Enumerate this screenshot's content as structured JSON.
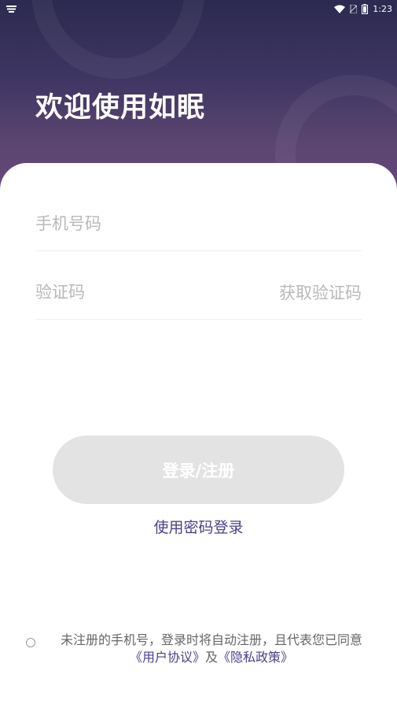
{
  "status_bar": {
    "time": "1:23",
    "icons": [
      "notification-icon",
      "wifi-icon",
      "no-sim-icon",
      "battery-icon"
    ]
  },
  "header": {
    "title": "欢迎使用如眠"
  },
  "form": {
    "phone_placeholder": "手机号码",
    "code_placeholder": "验证码",
    "get_code_label": "获取验证码",
    "submit_label": "登录/注册",
    "password_login_label": "使用密码登录"
  },
  "agreement": {
    "text": "未注册的手机号，登录时将自动注册，且代表您已同意",
    "user_agreement": "《用户协议》",
    "conjunction": "及",
    "privacy_policy": "《隐私政策》",
    "checked": false
  },
  "colors": {
    "header_top": "#2c2a50",
    "header_bottom": "#66487a",
    "accent": "#4b3f8a",
    "button_disabled": "#e3e3e3"
  }
}
